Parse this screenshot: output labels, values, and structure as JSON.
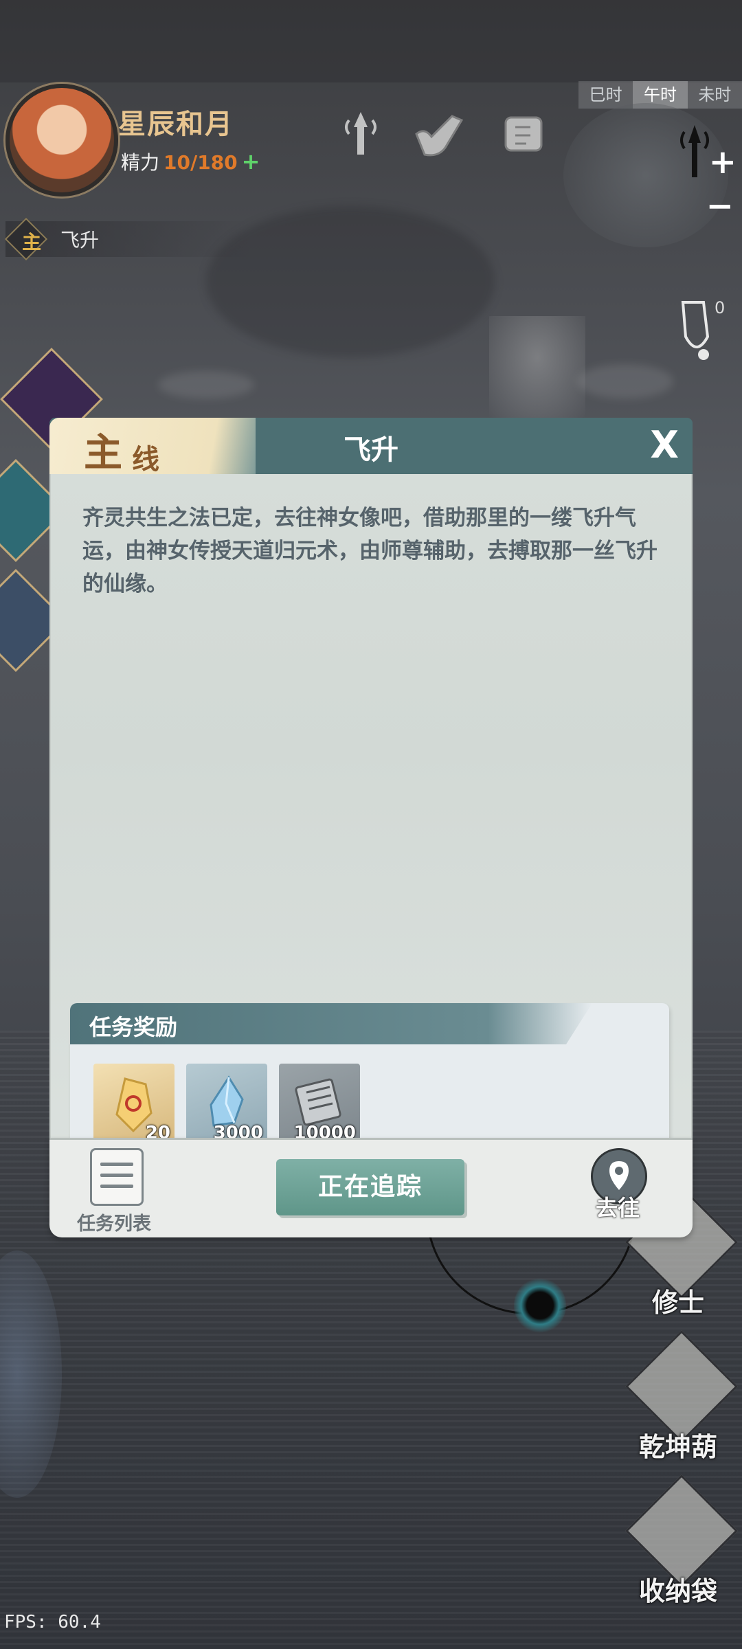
{
  "player": {
    "name": "星辰和月",
    "stamina_label": "精力",
    "stamina_value": "10/180",
    "stamina_add": "+"
  },
  "quest_tracker": {
    "badge": "主",
    "label": "飞升"
  },
  "time_bar": [
    "巳时",
    "午时",
    "未时"
  ],
  "minimap": {
    "zoom_in": "+",
    "zoom_out": "−"
  },
  "side_counter": "0",
  "dialog": {
    "type_char_1": "主",
    "type_char_2": "线",
    "title": "飞升",
    "close": "X",
    "description": "齐灵共生之法已定，去往神女像吧，借助那里的一缕飞升气运，由神女传授天道归元术，由师尊辅助，去搏取那一丝飞升的仙缘。",
    "rewards_title": "任务奖励",
    "rewards": [
      {
        "icon": "gold-crystal-icon",
        "count": "20"
      },
      {
        "icon": "blue-crystal-icon",
        "count": "3000"
      },
      {
        "icon": "scroll-icon",
        "count": "10000"
      }
    ],
    "task_list_label": "任务列表",
    "track_label": "正在追踪",
    "goto_label": "去往"
  },
  "right_buttons": [
    "修士",
    "乾坤葫",
    "收纳袋"
  ],
  "fps": "FPS: 60.4",
  "colors": {
    "dialog_header": "#4c6f73",
    "dialog_body": "#d6ddd9",
    "track_button": "#6fa397",
    "stamina_value": "#e07a2a",
    "accent_gold": "#e8c590"
  }
}
